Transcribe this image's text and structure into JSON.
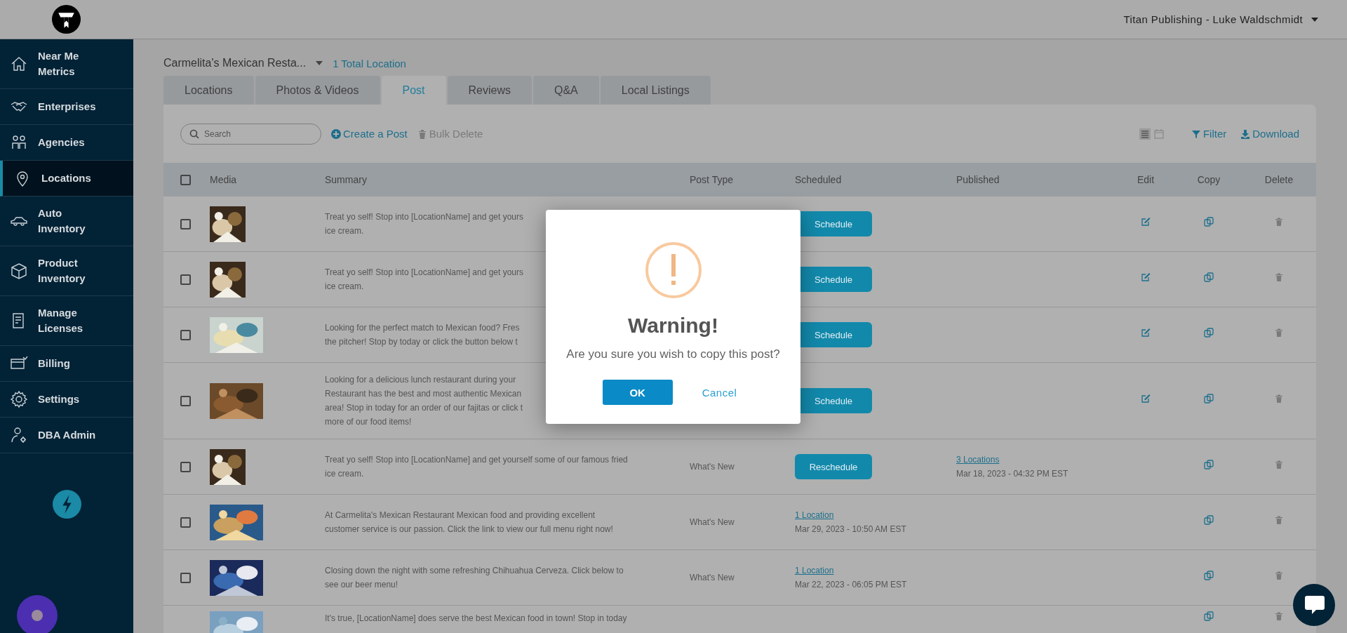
{
  "header": {
    "account": "Titan Publishing - Luke Waldschmidt"
  },
  "sidebar": {
    "items": [
      {
        "label": "Near Me Metrics",
        "selected": false
      },
      {
        "label": "Enterprises",
        "selected": false
      },
      {
        "label": "Agencies",
        "selected": false
      },
      {
        "label": "Locations",
        "selected": true
      },
      {
        "label": "Auto Inventory",
        "selected": false
      },
      {
        "label": "Product Inventory",
        "selected": false
      },
      {
        "label": "Manage Licenses",
        "selected": false
      },
      {
        "label": "Billing",
        "selected": false
      },
      {
        "label": "Settings",
        "selected": false
      },
      {
        "label": "DBA Admin",
        "selected": false
      }
    ]
  },
  "location_picker": {
    "value": "Carmelita's Mexican Resta...",
    "count": "1 Total Location"
  },
  "tabs": [
    {
      "label": "Locations",
      "selected": false
    },
    {
      "label": "Photos & Videos",
      "selected": false
    },
    {
      "label": "Post",
      "selected": true
    },
    {
      "label": "Reviews",
      "selected": false
    },
    {
      "label": "Q&A",
      "selected": false
    },
    {
      "label": "Local Listings",
      "selected": false
    }
  ],
  "toolbar": {
    "search": {
      "placeholder": "Search"
    },
    "create": "Create a Post",
    "bulk_delete": {
      "label": "Bulk Delete",
      "disabled": true
    },
    "filter": "Filter",
    "download": "Download"
  },
  "table": {
    "select_all": {
      "checked": false
    },
    "columns": [
      "Media",
      "Summary",
      "Post Type",
      "Scheduled",
      "Published",
      "Edit",
      "Copy",
      "Delete"
    ],
    "rows": [
      {
        "checked": false,
        "media": {
          "kind": "picture"
        },
        "summary_lines": [
          "Treat yo self! Stop into [LocationName] and get yours",
          "ice cream."
        ],
        "scheduled": {
          "kind": "button",
          "label": "Schedule"
        },
        "editable": true
      },
      {
        "checked": false,
        "media": {
          "kind": "picture"
        },
        "summary_lines": [
          "Treat yo self! Stop into [LocationName] and get yours",
          "ice cream."
        ],
        "scheduled": {
          "kind": "button",
          "label": "Schedule"
        },
        "editable": true
      },
      {
        "checked": false,
        "media": {
          "kind": "picture"
        },
        "summary_lines": [
          "Looking for the perfect match to Mexican food? Fres",
          "the pitcher! Stop by today or click the button below t"
        ],
        "scheduled": {
          "kind": "button",
          "label": "Schedule"
        },
        "editable": true
      },
      {
        "checked": false,
        "media": {
          "kind": "picture"
        },
        "summary_lines": [
          "Looking for a delicious lunch restaurant during your",
          "Restaurant has the best and most authentic Mexican",
          "area! Stop in today for an order of our fajitas or click t",
          "more of our food items!"
        ],
        "scheduled": {
          "kind": "button",
          "label": "Schedule"
        },
        "editable": true
      },
      {
        "checked": false,
        "media": {
          "kind": "picture"
        },
        "summary_lines": [
          "Treat yo self! Stop into [LocationName] and get yourself some of our famous fried",
          "ice cream."
        ],
        "post_type": "What's New",
        "scheduled": {
          "kind": "button",
          "label": "Reschedule"
        },
        "published": {
          "link": "3 Locations",
          "date": "Mar 18, 2023 - 04:32 PM EST"
        },
        "editable": false
      },
      {
        "checked": false,
        "media": {
          "kind": "picture"
        },
        "summary_lines": [
          "At Carmelita's Mexican Restaurant Mexican food and providing excellent",
          "customer service is our passion. Click the link to view our full menu right now!"
        ],
        "post_type": "What's New",
        "scheduled": {
          "kind": "link",
          "link": "1 Location",
          "date": "Mar 29, 2023 - 10:50 AM EST"
        },
        "editable": false
      },
      {
        "checked": false,
        "media": {
          "kind": "picture"
        },
        "summary_lines": [
          "Closing down the night with some refreshing Chihuahua Cerveza. Click below to",
          "see our beer menu!"
        ],
        "post_type": "What's New",
        "scheduled": {
          "kind": "link",
          "link": "1 Location",
          "date": "Mar 22, 2023 - 06:05 PM EST"
        },
        "editable": false
      },
      {
        "media": {
          "kind": "picture"
        },
        "summary_lines": [
          "It's true, [LocationName] does serve the best Mexican food in town! Stop in today"
        ],
        "editable": false
      }
    ]
  },
  "dialog": {
    "title": "Warning!",
    "message": "Are you sure you wish to copy this post?",
    "buttons": [
      {
        "kind": "primary",
        "label": "OK"
      },
      {
        "kind": "link",
        "label": "Cancel"
      }
    ]
  }
}
